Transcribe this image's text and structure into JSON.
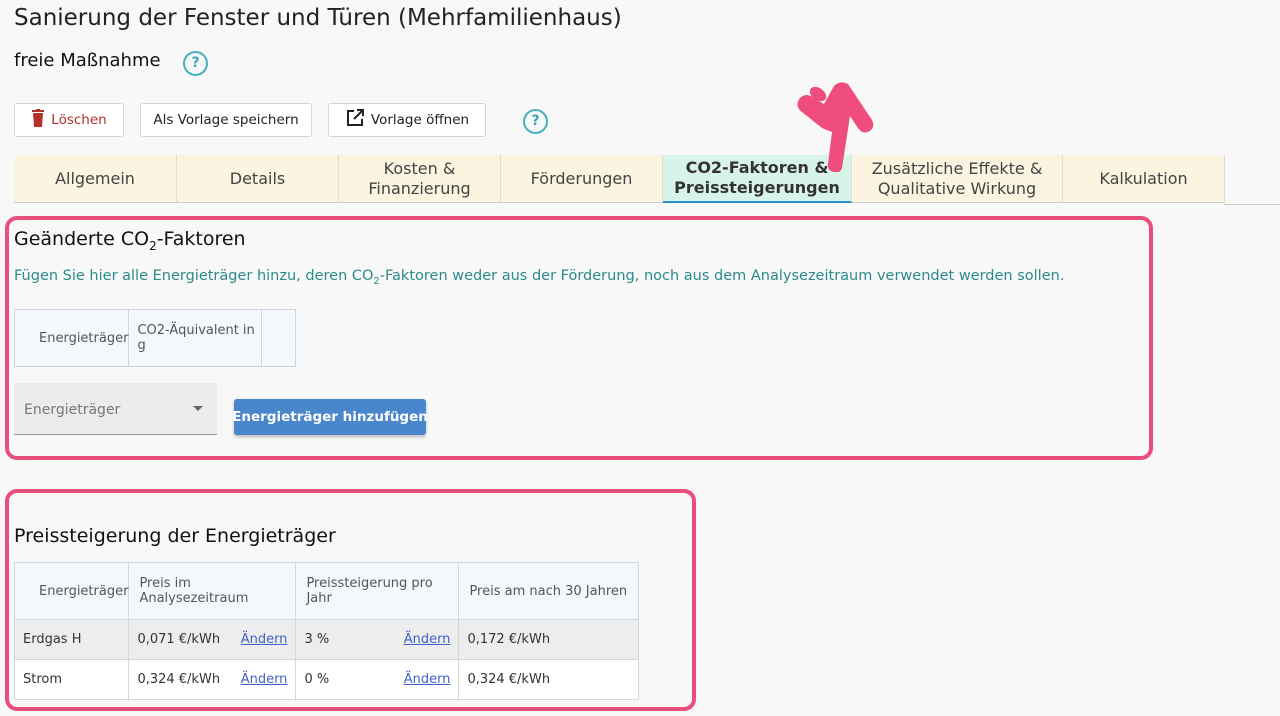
{
  "page": {
    "title": "Sanierung der Fenster und Türen (Mehrfamilienhaus)",
    "subtitle": "freie Maßnahme",
    "help_glyph": "?"
  },
  "toolbar": {
    "delete_label": "Löschen",
    "save_template_label": "Als Vorlage speichern",
    "open_template_label": "Vorlage öffnen"
  },
  "tabs": [
    {
      "label": "Allgemein",
      "active": false
    },
    {
      "label": "Details",
      "active": false
    },
    {
      "label": "Kosten &\nFinanzierung",
      "active": false
    },
    {
      "label": "Förderungen",
      "active": false
    },
    {
      "label": "CO2-Faktoren &\nPreissteigerungen",
      "active": true
    },
    {
      "label": "Zusätzliche Effekte &\nQualitative Wirkung",
      "active": false
    },
    {
      "label": "Kalkulation",
      "active": false
    }
  ],
  "co2": {
    "title_pre": "Geänderte CO",
    "title_sub": "2",
    "title_post": "-Faktoren",
    "info_pre": "Fügen Sie hier alle Energieträger hinzu, deren CO",
    "info_sub": "2",
    "info_post": "-Faktoren weder aus der Förderung, noch aus dem Analysezeitraum verwendet werden sollen.",
    "table_headers": [
      "Energieträger",
      "CO2-Äquivalent in g",
      ""
    ],
    "select_placeholder": "Energieträger",
    "add_button": "Energieträger hinzufügen"
  },
  "price": {
    "title": "Preissteigerung der Energieträger",
    "headers": [
      "Energieträger",
      "Preis im Analysezeitraum",
      "Preissteigerung pro Jahr",
      "Preis am nach 30 Jahren"
    ],
    "edit_label": "Ändern",
    "rows": [
      {
        "carrier": "Erdgas H",
        "price": "0,071 €/kWh",
        "increase": "3 %",
        "price_30": "0,172 €/kWh"
      },
      {
        "carrier": "Strom",
        "price": "0,324 €/kWh",
        "increase": "0 %",
        "price_30": "0,324 €/kWh"
      }
    ]
  },
  "colors": {
    "highlight_frame": "#e94f7c",
    "accent_teal": "#3aa6b8",
    "primary_button": "#4a86cc",
    "tab_background": "#faf4e1",
    "tab_active_background": "#d8f3e8"
  },
  "icons": [
    "help-icon",
    "trash-icon",
    "external-link-icon",
    "chevron-down-icon",
    "pointing-hand-icon"
  ]
}
